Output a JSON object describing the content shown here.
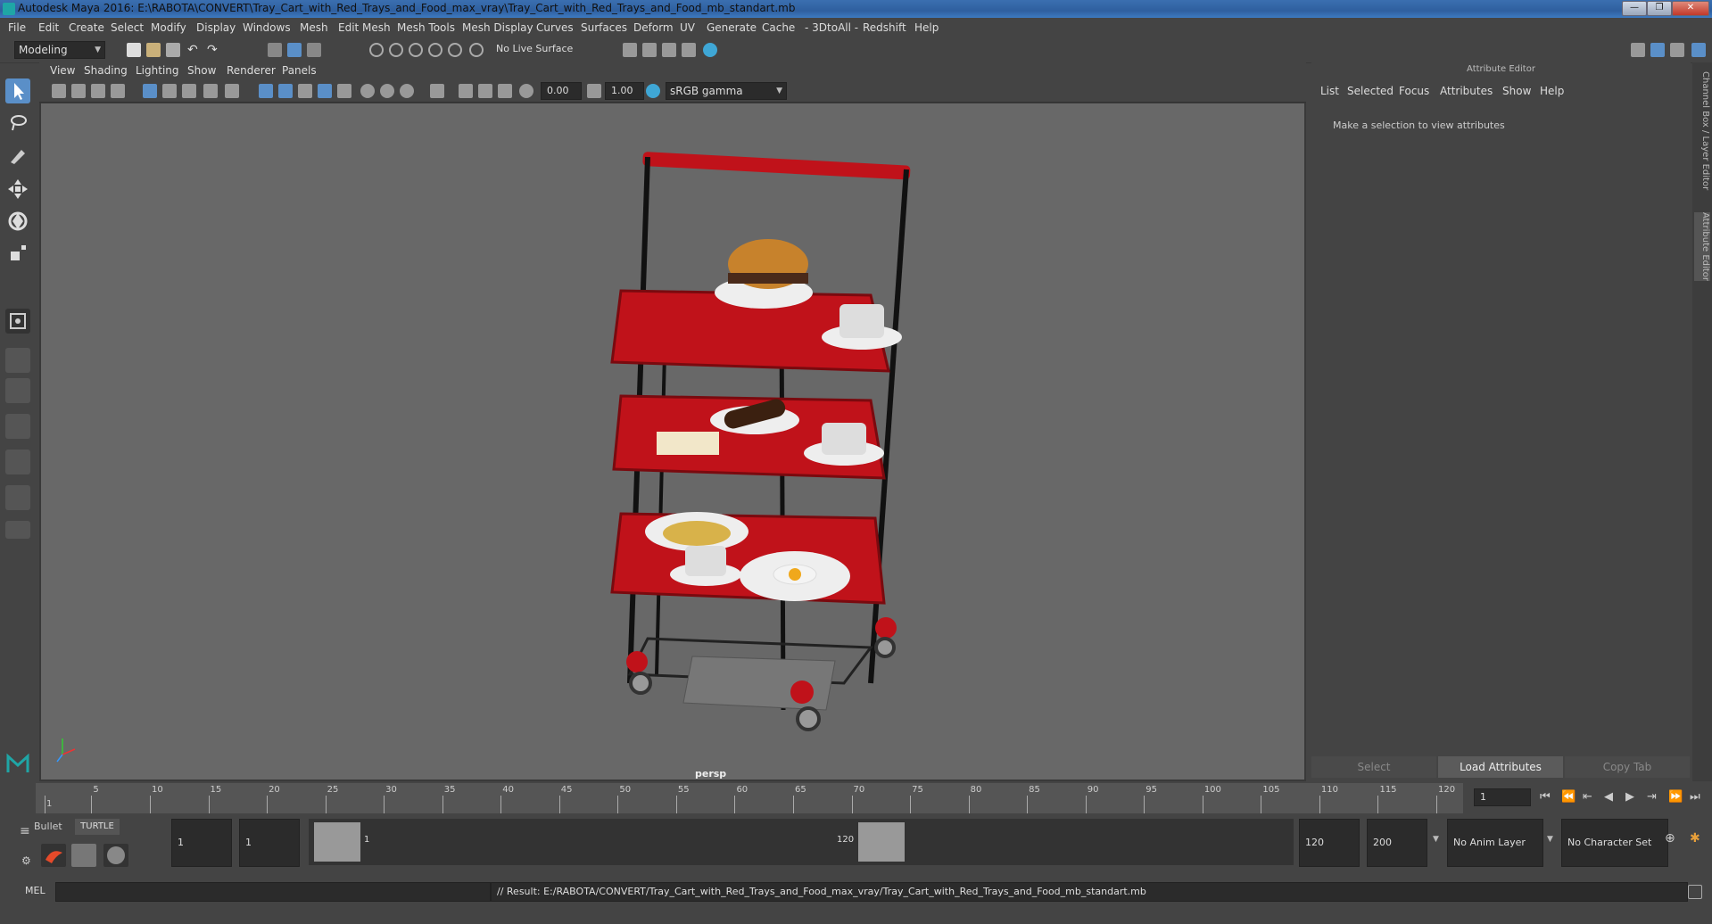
{
  "window": {
    "title": "Autodesk Maya 2016: E:\\RABOTA\\CONVERT\\Tray_Cart_with_Red_Trays_and_Food_max_vray\\Tray_Cart_with_Red_Trays_and_Food_mb_standart.mb"
  },
  "menubar": {
    "items": [
      "File",
      "Edit",
      "Create",
      "Select",
      "Modify",
      "Display",
      "Windows",
      "Mesh",
      "Edit Mesh",
      "Mesh Tools",
      "Mesh Display",
      "Curves",
      "Surfaces",
      "Deform",
      "UV",
      "Generate",
      "Cache",
      "- 3DtoAll -",
      "Redshift",
      "Help"
    ]
  },
  "shelf": {
    "mode": "Modeling",
    "live_surface": "No Live Surface"
  },
  "panel_menu": {
    "items": [
      "View",
      "Shading",
      "Lighting",
      "Show",
      "Renderer",
      "Panels"
    ]
  },
  "view_tools": {
    "exposure": "0.00",
    "gamma": "1.00",
    "color_space": "sRGB gamma"
  },
  "viewport": {
    "camera_label": "persp"
  },
  "attribute_editor": {
    "title": "Attribute Editor",
    "menu": [
      "List",
      "Selected",
      "Focus",
      "Attributes",
      "Show",
      "Help"
    ],
    "message": "Make a selection to view attributes",
    "buttons": {
      "select": "Select",
      "load": "Load Attributes",
      "copy": "Copy Tab"
    }
  },
  "side_tabs": {
    "channel_box": "Channel Box / Layer Editor",
    "attribute_editor": "Attribute Editor"
  },
  "timeline": {
    "ticks": [
      "1",
      "5",
      "10",
      "15",
      "20",
      "25",
      "30",
      "35",
      "40",
      "45",
      "50",
      "55",
      "60",
      "65",
      "70",
      "75",
      "80",
      "85",
      "90",
      "95",
      "100",
      "105",
      "110",
      "115",
      "120"
    ],
    "current_frame": "1"
  },
  "range": {
    "shelf_tabs": [
      "Bullet",
      "TURTLE"
    ],
    "start": "1",
    "playback_start": "1",
    "range_start_label": "1",
    "range_end_label": "120",
    "playback_end": "120",
    "end": "200",
    "anim_layer": "No Anim Layer",
    "character_set": "No Character Set"
  },
  "command": {
    "lang": "MEL",
    "result": "// Result: E:/RABOTA/CONVERT/Tray_Cart_with_Red_Trays_and_Food_max_vray/Tray_Cart_with_Red_Trays_and_Food_mb_standart.mb"
  },
  "colors": {
    "accent": "#5a8fc8",
    "tray_red": "#c0121a",
    "viewport_bg": "#686868"
  }
}
